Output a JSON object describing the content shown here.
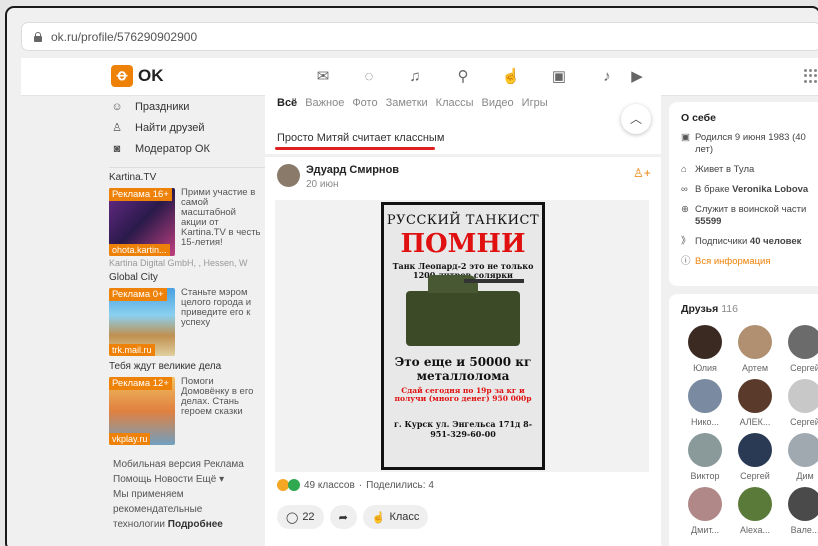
{
  "browser": {
    "url": "ok.ru/profile/576290902900"
  },
  "topnav": {
    "logo_text": "OK",
    "icons": [
      "mail-icon",
      "chat-icon",
      "bell-icon",
      "guests-icon",
      "like-icon",
      "video-icon",
      "music-icon",
      "tv-icon"
    ],
    "brand_color": "#ee8208"
  },
  "left": {
    "menu": [
      {
        "icon": "holidays-icon",
        "label": "Праздники"
      },
      {
        "icon": "find-friends-icon",
        "label": "Найти друзей"
      },
      {
        "icon": "moderator-icon",
        "label": "Модератор ОК"
      }
    ],
    "ads": [
      {
        "title": "Kartina.TV",
        "badge": "Реклама 16+",
        "caption": "ohota.kartin...",
        "desc": "Прими участие в самой масштабной акции от Kartina.TV в честь 15-летия!",
        "sub": "Kartina Digital GmbH, , Hessen, W"
      },
      {
        "title": "Global City",
        "badge": "Реклама 0+",
        "caption": "trk.mail.ru",
        "desc": "Станьте мэром целого города и приведите его к успеху",
        "sub": ""
      },
      {
        "title": "Тебя ждут великие дела",
        "badge": "Реклама 12+",
        "caption": "vkplay.ru",
        "desc": "Помоги Домовёнку в его делах. Стань героем сказки",
        "sub": ""
      }
    ],
    "footer": {
      "line1": "Мобильная версия  Реклама",
      "line2": "Помощь  Новости  Ещё ▾",
      "line3": "Мы применяем",
      "line4": "рекомендательные",
      "line5": "технологии",
      "more": "Подробнее"
    }
  },
  "feed": {
    "tabs": [
      "Всё",
      "Важное",
      "Фото",
      "Заметки",
      "Классы",
      "Видео",
      "Игры"
    ],
    "active_tab": "Всё",
    "filter_label": "Просто Митяй считает классным",
    "post": {
      "author": "Эдуард Смирнов",
      "date": "20 июн",
      "poster": {
        "line1": "РУССКИЙ ТАНКИСТ",
        "line2": "ПОМНИ",
        "line3": "Танк Леопард-2 это не только 1200 литров солярки",
        "line4": "Это еще и 50000 кг металлолома",
        "line5": "Сдай сегодня по 19р за кг и получи (много денег) 950 000р",
        "line6": "г. Курск ул. Энгельса 171д 8-951-329-60-00"
      },
      "reactions": "49 классов",
      "shares": "Поделились: 4",
      "comments_count": "22",
      "like_label": "Класс"
    }
  },
  "about": {
    "title": "О себе",
    "born": "Родился 9 июня 1983 (40 лет)",
    "lives": "Живет в Тула",
    "married_prefix": "В браке",
    "married_name": "Veronika Lobova",
    "military_prefix": "Служит в воинской части",
    "military_unit": "55599",
    "subs_prefix": "Подписчики",
    "subs_value": "40 человек",
    "all_info": "Вся информация"
  },
  "friends": {
    "title": "Друзья",
    "count": "116",
    "list": [
      {
        "name": "Юлия",
        "color": "#3a2a22"
      },
      {
        "name": "Артем",
        "color": "#b09070"
      },
      {
        "name": "Сергей",
        "color": "#6b6b6b"
      },
      {
        "name": "Нико...",
        "color": "#7a8aa0"
      },
      {
        "name": "АЛЕК...",
        "color": "#5a3a2a"
      },
      {
        "name": "Сергей",
        "color": "#c8c8c8"
      },
      {
        "name": "Виктор",
        "color": "#8a9a9a"
      },
      {
        "name": "Сергей",
        "color": "#2a3a55"
      },
      {
        "name": "Дим",
        "color": "#a0a8b0"
      },
      {
        "name": "Дмит...",
        "color": "#b08888"
      },
      {
        "name": "Alexa...",
        "color": "#5a7a3a"
      },
      {
        "name": "Вале...",
        "color": "#4a4a4a"
      }
    ]
  }
}
